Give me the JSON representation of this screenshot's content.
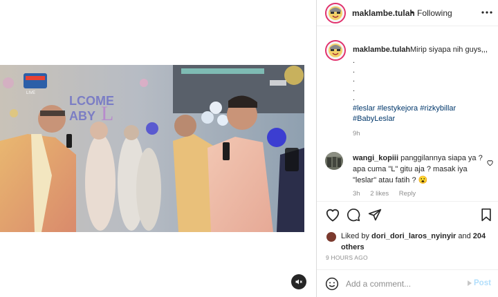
{
  "media": {
    "mute_icon": "speaker-muted-icon"
  },
  "header": {
    "username": "maklambe.tulah",
    "separator": "•",
    "follow_status": "Following",
    "more_icon": "more-options-icon"
  },
  "caption": {
    "username": "maklambe.tulah",
    "text": "Mirip siyapa nih guys,,,",
    "dots": [
      ".",
      ".",
      ".",
      ".",
      "."
    ],
    "hashtags": "#leslar #lestykejora #rizkybillar #BabyLeslar",
    "time": "9h"
  },
  "comment": {
    "username": "wangi_kopiii",
    "text": "panggilannya siapa ya ? apa cuma \"L\" gitu aja ? masak iya \"leslar\" atau fatih ? 😮",
    "time": "3h",
    "likes": "2 likes",
    "reply": "Reply",
    "like_icon": "heart-outline-icon"
  },
  "actions": {
    "like_icon": "heart-icon",
    "comment_icon": "comment-icon",
    "share_icon": "share-icon",
    "save_icon": "bookmark-icon"
  },
  "likes": {
    "prefix": "Liked by",
    "user": "dori_dori_laros_nyinyir",
    "conjunction": "and",
    "others": "204 others"
  },
  "time_ago": "9 HOURS AGO",
  "add_comment": {
    "placeholder": "Add a comment...",
    "post_label": "Post",
    "emoji_icon": "emoji-icon"
  },
  "colors": {
    "link": "#00376b",
    "muted": "#8e8e8e",
    "post_disabled": "#b2dffc",
    "avatar_ring": "#e1306c"
  }
}
